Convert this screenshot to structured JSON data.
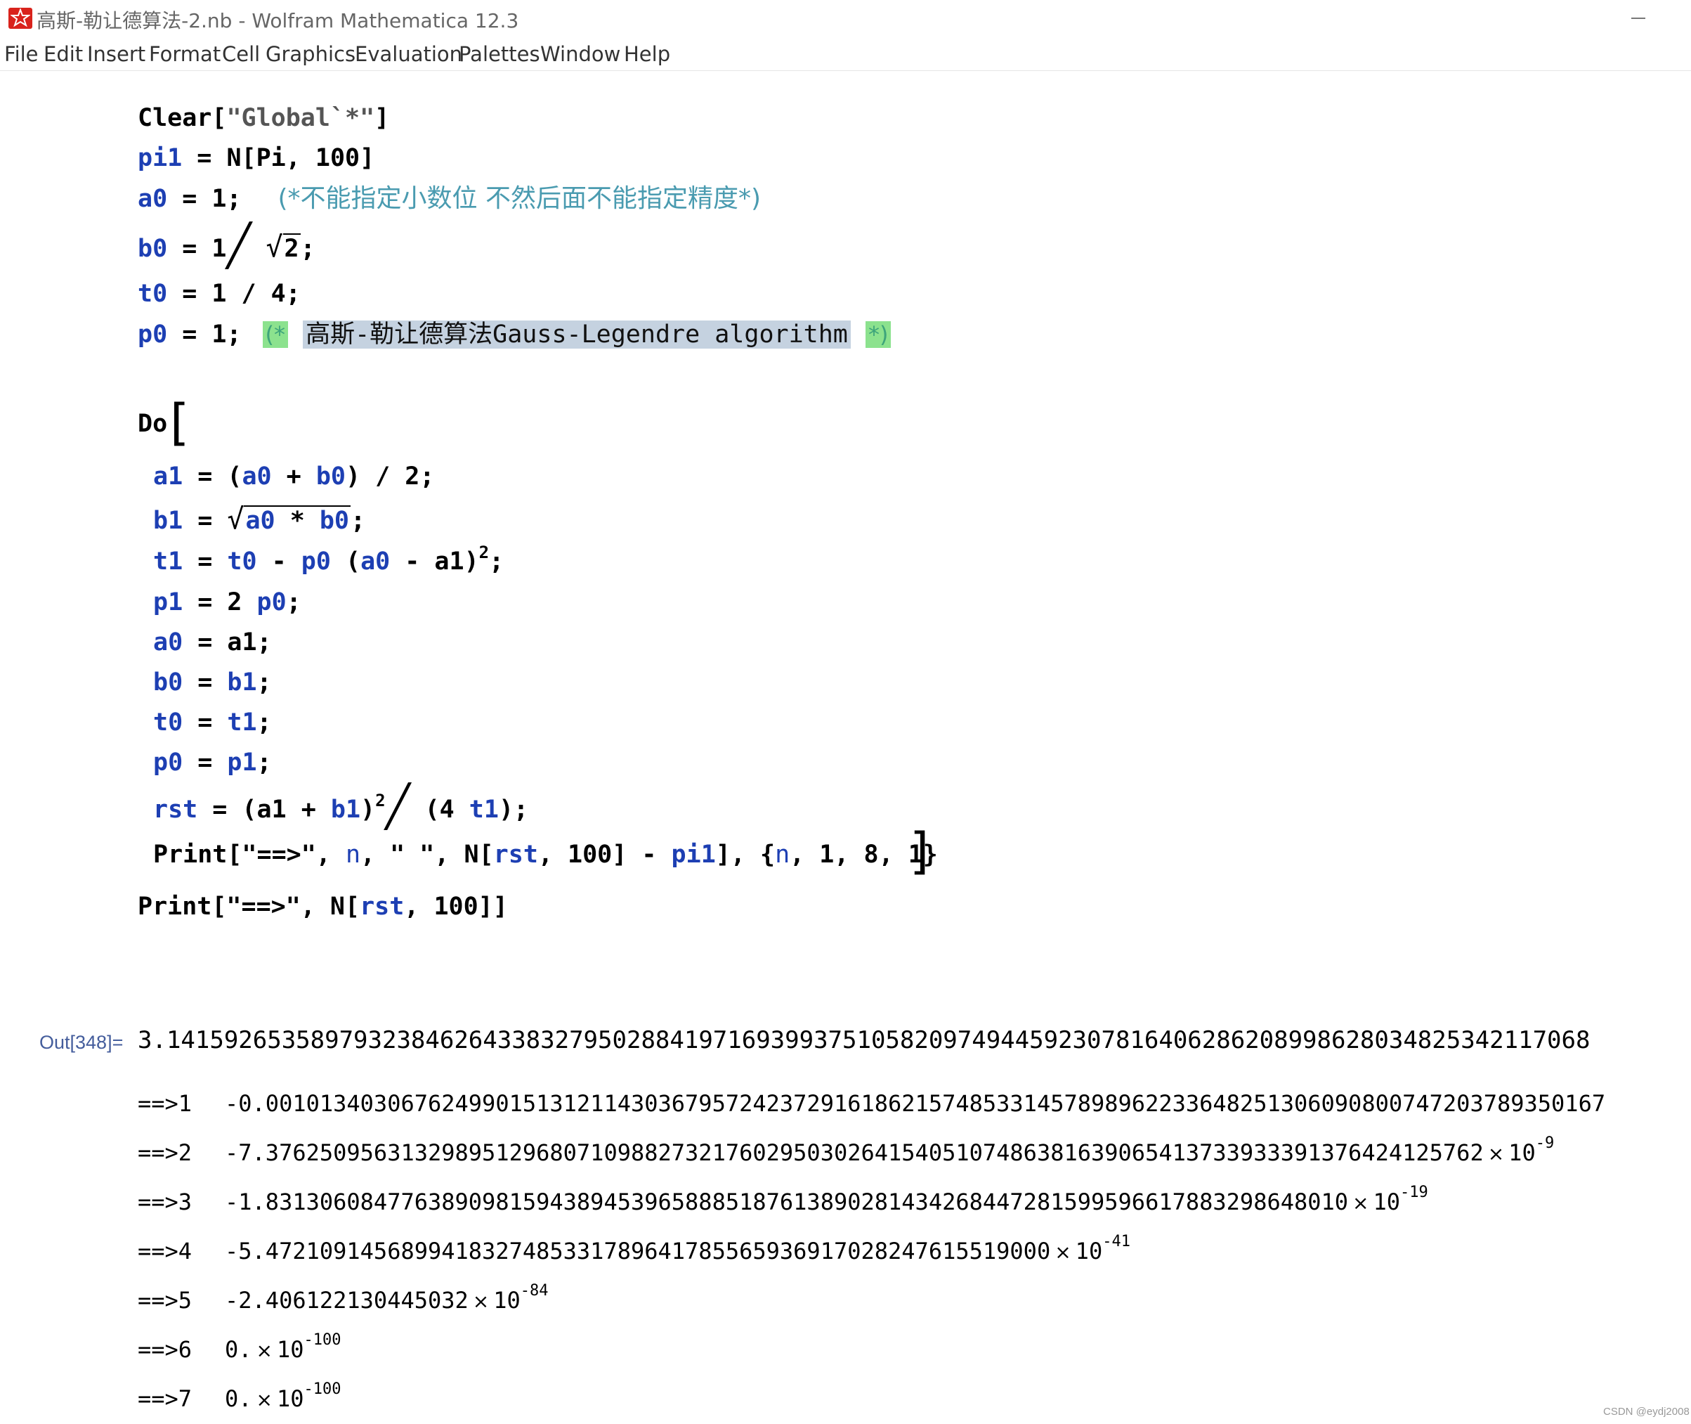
{
  "window": {
    "title": "高斯-勒让德算法-2.nb - Wolfram Mathematica 12.3"
  },
  "menu": [
    "File",
    "Edit",
    "Insert",
    "Format",
    "Cell",
    "Graphics",
    "Evaluation",
    "Palettes",
    "Window",
    "Help"
  ],
  "code": {
    "clear": {
      "fn": "Clear",
      "lb": "[",
      "str": "\"Global`*\"",
      "rb": "]"
    },
    "pi1": {
      "var": "pi1",
      "eq": " = ",
      "expr": "N[Pi, 100]"
    },
    "a0": {
      "var": "a0",
      "rest": " = 1;",
      "comment": "(*不能指定小数位 不然后面不能指定精度*)"
    },
    "b0": {
      "var": "b0",
      "eq": " = 1",
      "root": "2",
      "end": ";"
    },
    "t0": {
      "var": "t0",
      "rest": " = 1 / 4;"
    },
    "p0": {
      "var": "p0",
      "rest": " = 1;",
      "c_open": "(*",
      "c_text": "高斯-勒让德算法Gauss-Legendre algorithm",
      "c_close": "*)"
    },
    "do": "Do",
    "body": {
      "a1": {
        "lhs": "a1",
        "eq": " = (",
        "v1": "a0",
        "op": " + ",
        "v2": "b0",
        "tail": ") / 2;"
      },
      "b1": {
        "lhs": "b1",
        "eq": " = ",
        "v1": "a0",
        "op": " * ",
        "v2": "b0",
        "end": ";"
      },
      "t1": {
        "lhs": "t1",
        "eq": " = ",
        "v1": "t0",
        "op": " - ",
        "v2": "p0",
        "p": " (",
        "v3": "a0",
        "tail": " - a1)",
        "exp": "2",
        "end": ";"
      },
      "p1": {
        "lhs": "p1",
        "eq": " = 2 ",
        "v1": "p0",
        "end": ";"
      },
      "a0u": {
        "lhs": "a0",
        "rest": " = a1;"
      },
      "b0u": {
        "lhs": "b0",
        "eq": " = ",
        "v1": "b1",
        "end": ";"
      },
      "t0u": {
        "lhs": "t0",
        "eq": " = ",
        "v1": "t1",
        "end": ";"
      },
      "p0u": {
        "lhs": "p0",
        "eq": " = ",
        "v1": "p1",
        "end": ";"
      },
      "rst": {
        "lhs": "rst",
        "eq": " = (a1 + ",
        "v1": "b1",
        "close": ")",
        "exp": "2",
        "den": "(4 ",
        "v2": "t1",
        "end": ");"
      },
      "print": {
        "fn": "Print",
        "a": "[\"==>\", ",
        "n": "n",
        "b": ", \"  \", N[",
        "rst": "rst",
        "c": ", 100] - ",
        "pi1": "pi1",
        "d": "], {",
        "n2": "n",
        "e": ", 1, 8, 1}"
      }
    },
    "final": {
      "fn": "Print",
      "a": "[\"==>\", N[",
      "rst": "rst",
      "b": ", 100]]"
    }
  },
  "output": {
    "label": "Out[348]=",
    "value": "3.141592653589793238462643383279502884197169399375105820974944592307816406286208998628034825342117068"
  },
  "prints": [
    {
      "prefix": "==>1",
      "value": "-0.001013403067624990151312114303679572423729161862157485331457898962233648251306090800747203789350167",
      "exp": ""
    },
    {
      "prefix": "==>2",
      "value": "-7.3762509563132989512968071098827321760295030264154051074863816390654137339333913764241257​62",
      "exp": "-9"
    },
    {
      "prefix": "==>3",
      "value": "-1.831306084776389098159438945396588851876138902814342684472815995966178832986480​10",
      "exp": "-19"
    },
    {
      "prefix": "==>4",
      "value": "-5.472109145689941832748533178964178556593691702824761551​9000",
      "exp": "-41"
    },
    {
      "prefix": "==>5",
      "value": "-2.406122130445032",
      "exp": "-84"
    },
    {
      "prefix": "==>6",
      "value": "0.",
      "exp": "-100"
    },
    {
      "prefix": "==>7",
      "value": "0.",
      "exp": "-100"
    }
  ],
  "times_sign": "×",
  "ten": "10",
  "watermark": "CSDN @eydj2008"
}
